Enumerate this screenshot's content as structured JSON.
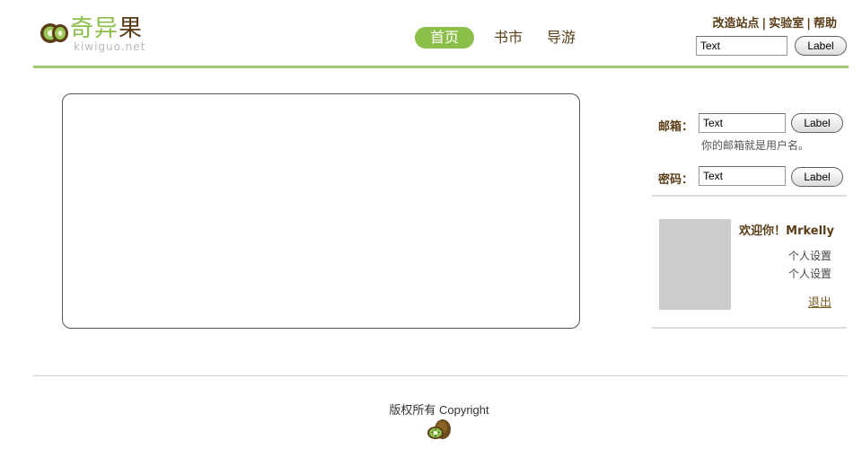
{
  "brand": {
    "name_green": "奇异",
    "name_dark": "果",
    "domain": "kiwiguo.net"
  },
  "nav": {
    "home": "首页",
    "books": "书市",
    "guide": "导游"
  },
  "top_links": {
    "change_site": "改造站点",
    "lab": "实验室",
    "help": "帮助",
    "separator": "|"
  },
  "header_search": {
    "value": "Text",
    "button_label": "Label"
  },
  "login": {
    "email_label": "邮箱：",
    "email_value": "Text",
    "email_button": "Label",
    "email_hint": "你的邮箱就是用户名。",
    "password_label": "密码：",
    "password_value": "Text",
    "password_button": "Label"
  },
  "user_panel": {
    "welcome": "欢迎你！Mrkelly",
    "setting_1": "个人设置",
    "setting_2": "个人设置",
    "logout": "退出"
  },
  "footer": {
    "copyright": "版权所有 Copyright"
  },
  "colors": {
    "accent_green": "#8cbf4a",
    "brand_brown": "#5a3d17",
    "rule_green": "#a3c977",
    "avatar_gray": "#cccccc"
  },
  "icons": {
    "logo": "kiwi-slices-icon",
    "footer": "kiwi-fruit-icon"
  }
}
